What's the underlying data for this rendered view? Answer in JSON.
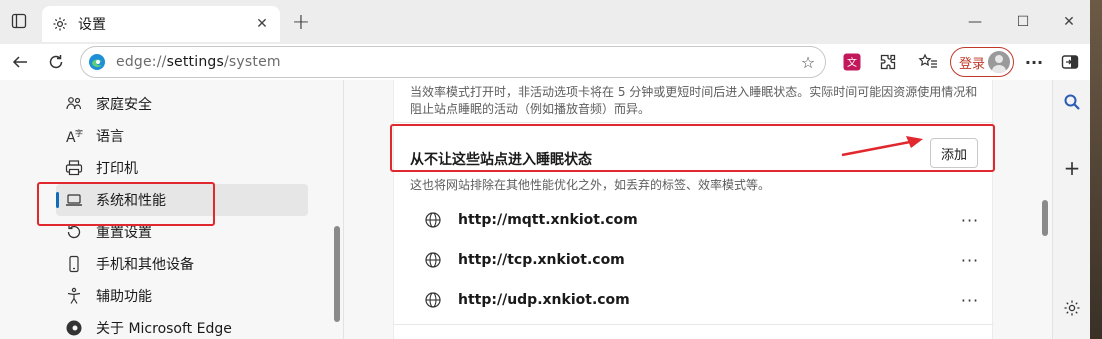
{
  "tab": {
    "title": "设置",
    "close": "✕"
  },
  "newtab": "+",
  "window_controls": {
    "minimize": "—",
    "maximize": "☐",
    "close": "✕"
  },
  "address": {
    "scheme": "edge://",
    "host": "settings",
    "path": "/system"
  },
  "toolbar": {
    "login_label": "登录",
    "more": "···"
  },
  "sidebar": {
    "items": [
      {
        "label": "家庭安全",
        "icon": "family-icon"
      },
      {
        "label": "语言",
        "icon": "language-icon"
      },
      {
        "label": "打印机",
        "icon": "printer-icon"
      },
      {
        "label": "系统和性能",
        "icon": "laptop-icon",
        "active": true
      },
      {
        "label": "重置设置",
        "icon": "reset-icon"
      },
      {
        "label": "手机和其他设备",
        "icon": "phone-icon"
      },
      {
        "label": "辅助功能",
        "icon": "accessibility-icon"
      },
      {
        "label": "关于 Microsoft Edge",
        "icon": "edge-icon"
      }
    ]
  },
  "main": {
    "efficiency_desc": "当效率模式打开时，非活动选项卡将在 5 分钟或更短时间后进入睡眠状态。实际时间可能因资源使用情况和阻止站点睡眠的活动（例如播放音频）而异。",
    "never_sleep_title": "从不让这些站点进入睡眠状态",
    "add_button": "添加",
    "never_sleep_desc": "这也将网站排除在其他性能优化之外，如丢弃的标签、效率模式等。",
    "sites": [
      {
        "url": "http://mqtt.xnkiot.com",
        "more": "···"
      },
      {
        "url": "http://tcp.xnkiot.com",
        "more": "···"
      },
      {
        "url": "http://udp.xnkiot.com",
        "more": "···"
      }
    ]
  },
  "colors": {
    "highlight_red": "#e0282e",
    "accent_blue": "#0f6cbd"
  }
}
